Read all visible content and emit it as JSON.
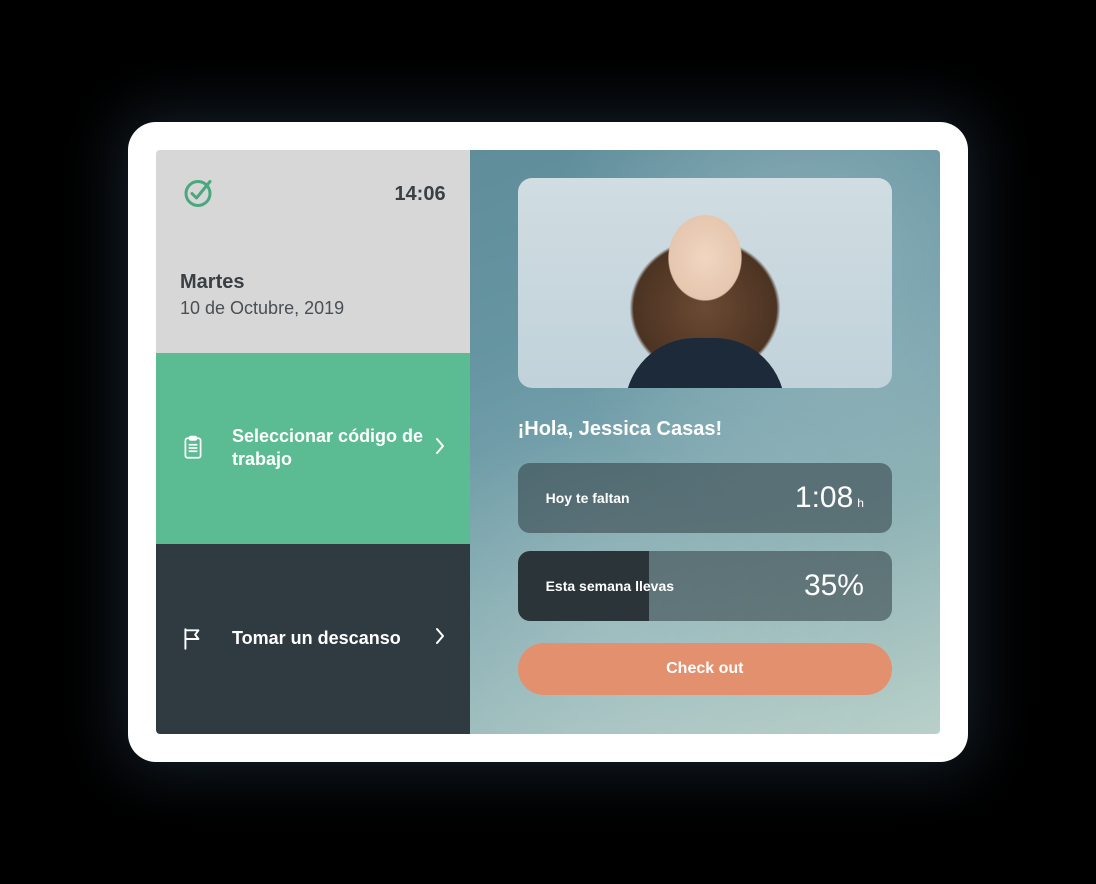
{
  "header": {
    "time": "14:06",
    "day": "Martes",
    "date": "10 de Octubre, 2019"
  },
  "menu": {
    "workcode": {
      "label": "Seleccionar código de trabajo"
    },
    "break": {
      "label": "Tomar un descanso"
    }
  },
  "main": {
    "greeting": "¡Hola, Jessica Casas!",
    "remaining": {
      "label": "Hoy te faltan",
      "value": "1:08",
      "unit": "h"
    },
    "week_progress": {
      "label": "Esta semana llevas",
      "value": "35%",
      "percent": 35
    },
    "checkout_label": "Check out"
  },
  "colors": {
    "accent_green": "#5bbb92",
    "dark_panel": "#2f3a41",
    "checkout": "#e2906e"
  }
}
